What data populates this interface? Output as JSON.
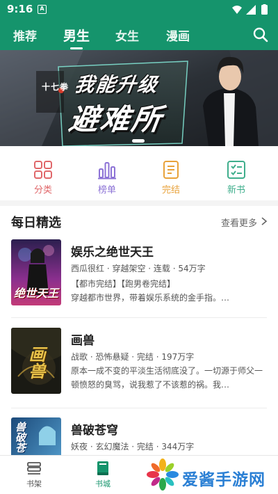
{
  "status_bar": {
    "time": "9:16",
    "notif_letter": "A"
  },
  "nav": {
    "tabs": [
      {
        "label": "推荐"
      },
      {
        "label": "男生",
        "active": true
      },
      {
        "label": "女生"
      },
      {
        "label": "漫画"
      }
    ],
    "search_icon": "search-icon"
  },
  "banner": {
    "author_text": "十七拳",
    "title_line1": "我能升级",
    "title_line2": "避难所"
  },
  "categories": [
    {
      "label": "分类",
      "icon": "grid-icon",
      "color": "#e0676a"
    },
    {
      "label": "榜单",
      "icon": "bar-chart-icon",
      "color": "#8c72d6"
    },
    {
      "label": "完结",
      "icon": "document-icon",
      "color": "#e8a23a"
    },
    {
      "label": "新书",
      "icon": "checklist-icon",
      "color": "#3fae8c"
    }
  ],
  "section": {
    "title": "每日精选",
    "more": "查看更多"
  },
  "books": [
    {
      "title": "娱乐之绝世天王",
      "meta": "西瓜很红 · 穿越架空 · 连载 · 54万字",
      "tags": "【都市完结】【跑男卷完结】",
      "desc": "穿越都市世界，带着娱乐系统的金手指。…",
      "cover_text": "绝世天王"
    },
    {
      "title": "画兽",
      "meta": "战歌 · 恐怖悬疑 · 完结 · 197万字",
      "desc": "原本一成不变的平淡生活彻底没了。一切源于师父一顿愤怒的臭骂，说我惹了不该惹的祸。我…",
      "cover_text": "画兽"
    },
    {
      "title": "兽破苍穹",
      "meta": "妖夜 · 玄幻魔法 · 完结 · 344万字",
      "cover_text": "兽破苍"
    }
  ],
  "bottom_tabs": [
    {
      "label": "书架",
      "icon": "bookshelf-icon"
    },
    {
      "label": "书城",
      "icon": "book-icon",
      "active": true
    }
  ],
  "watermark": {
    "name": "爱酱手游网"
  },
  "colors": {
    "brand": "#15946c",
    "watermark_blue": "#2a7fd4"
  }
}
